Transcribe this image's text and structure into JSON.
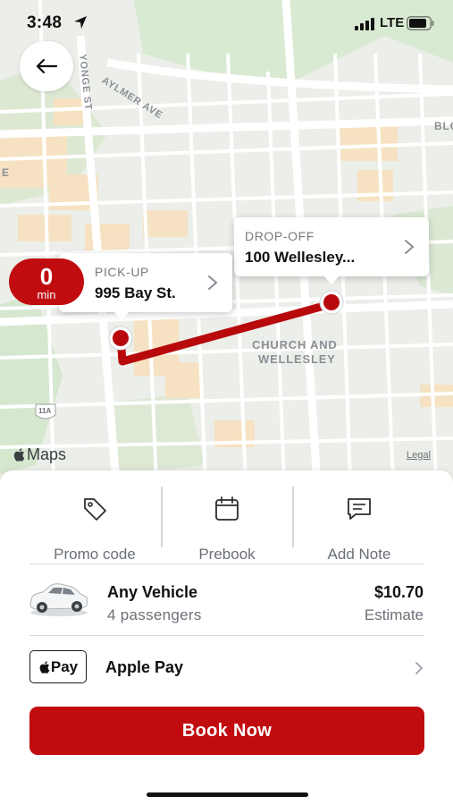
{
  "status_bar": {
    "time": "3:48",
    "network": "LTE",
    "location_icon": "location-arrow-icon",
    "signal_icon": "cellular-signal-icon",
    "battery_icon": "battery-icon"
  },
  "map": {
    "back_icon": "arrow-left-icon",
    "street_labels": {
      "yonge": "YONGE ST",
      "aylmer": "AYLMER AVE",
      "blo": "BLO",
      "e": "E",
      "church_line1": "CHURCH AND",
      "church_line2": "WELLESLEY",
      "route_shield": "11A"
    },
    "eta": {
      "value": "0",
      "unit": "min"
    },
    "pickup": {
      "label": "PICK-UP",
      "address": "995 Bay St."
    },
    "dropoff": {
      "label": "DROP-OFF",
      "address": "100 Wellesley..."
    },
    "maps_brand": "Maps",
    "legal": "Legal",
    "route_color": "#b8090c"
  },
  "actions": [
    {
      "label": "Promo code",
      "icon": "tag-icon"
    },
    {
      "label": "Prebook",
      "icon": "calendar-icon"
    },
    {
      "label": "Add Note",
      "icon": "message-icon"
    }
  ],
  "vehicle": {
    "name": "Any Vehicle",
    "capacity": "4 passengers",
    "price": "$10.70",
    "price_note": "Estimate",
    "icon": "car-icon"
  },
  "payment": {
    "badge_text": "Pay",
    "method": "Apple Pay",
    "icon": "apple-pay-icon"
  },
  "book_button": "Book Now",
  "colors": {
    "brand_red": "#c00c0f",
    "text_secondary": "#6b7078",
    "divider": "#d5d8dc"
  }
}
